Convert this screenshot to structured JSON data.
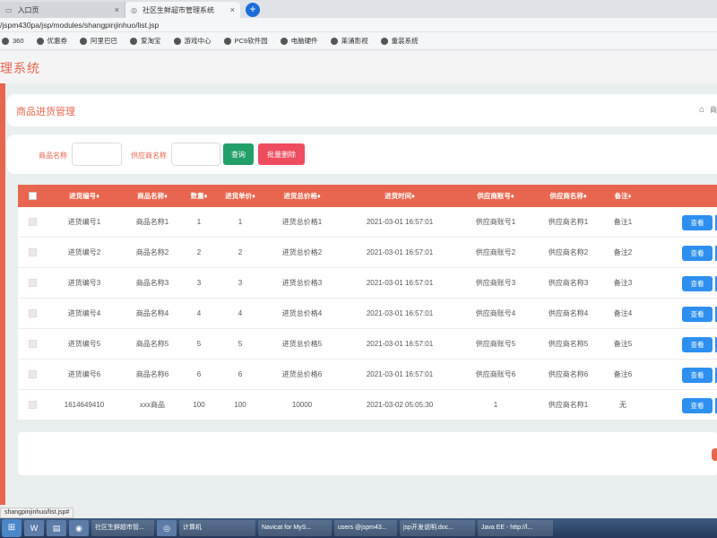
{
  "browser": {
    "tabs": [
      {
        "label": "入口页",
        "icon": "page-icon"
      },
      {
        "label": "社区生鲜超市管理系统",
        "icon": "globe-icon"
      }
    ],
    "new_tab": "+",
    "close": "×",
    "url": "/jspm430pa/jsp/modules/shangpinjinhuo/list.jsp",
    "bookmarks": [
      "360",
      "优惠券",
      "阿里巴巴",
      "爱淘宝",
      "游戏中心",
      "PC9软件园",
      "电脑硬件",
      "莱涌影视",
      "重装系统"
    ]
  },
  "app": {
    "title": "理系统"
  },
  "panel": {
    "title": "商品进货管理",
    "breadcrumb_home": "⌂",
    "breadcrumb_text": "商"
  },
  "search": {
    "label_product": "商品名称",
    "label_supplier": "供应商名称",
    "product_value": "",
    "supplier_value": "",
    "search_button": "查询",
    "batch_delete_button": "批量删除"
  },
  "table": {
    "headers": [
      "进货编号",
      "商品名称",
      "数量",
      "进货单价",
      "进货总价格",
      "进货时间",
      "供应商账号",
      "供应商名称",
      "备注"
    ],
    "rows": [
      [
        "进货编号1",
        "商品名称1",
        "1",
        "1",
        "进货总价格1",
        "2021-03-01 16:57:01",
        "供应商账号1",
        "供应商名称1",
        "备注1"
      ],
      [
        "进货编号2",
        "商品名称2",
        "2",
        "2",
        "进货总价格2",
        "2021-03-01 16:57:01",
        "供应商账号2",
        "供应商名称2",
        "备注2"
      ],
      [
        "进货编号3",
        "商品名称3",
        "3",
        "3",
        "进货总价格3",
        "2021-03-01 16:57:01",
        "供应商账号3",
        "供应商名称3",
        "备注3"
      ],
      [
        "进货编号4",
        "商品名称4",
        "4",
        "4",
        "进货总价格4",
        "2021-03-01 16:57:01",
        "供应商账号4",
        "供应商名称4",
        "备注4"
      ],
      [
        "进货编号5",
        "商品名称5",
        "5",
        "5",
        "进货总价格5",
        "2021-03-01 16:57:01",
        "供应商账号5",
        "供应商名称5",
        "备注5"
      ],
      [
        "进货编号6",
        "商品名称6",
        "6",
        "6",
        "进货总价格6",
        "2021-03-01 16:57:01",
        "供应商账号6",
        "供应商名称6",
        "备注6"
      ],
      [
        "1614649410",
        "xxx商品",
        "100",
        "100",
        "10000",
        "2021-03-02 05:05:30",
        "1",
        "供应商名称1",
        "无"
      ]
    ],
    "view_button": "查看"
  },
  "status_bar": "shangpinjinhuo/list.jsp#",
  "taskbar": {
    "items": [
      "社区生鲜超市管...",
      "计算机",
      "Navicat for MyS...",
      "users @jspm43...",
      "jsp开发说明.doc...",
      "Java EE - http://l..."
    ]
  },
  "colors": {
    "accent": "#e8664f",
    "search_btn": "#23a069",
    "delete_btn": "#ef4c5f",
    "view_btn": "#2d8ff0"
  }
}
